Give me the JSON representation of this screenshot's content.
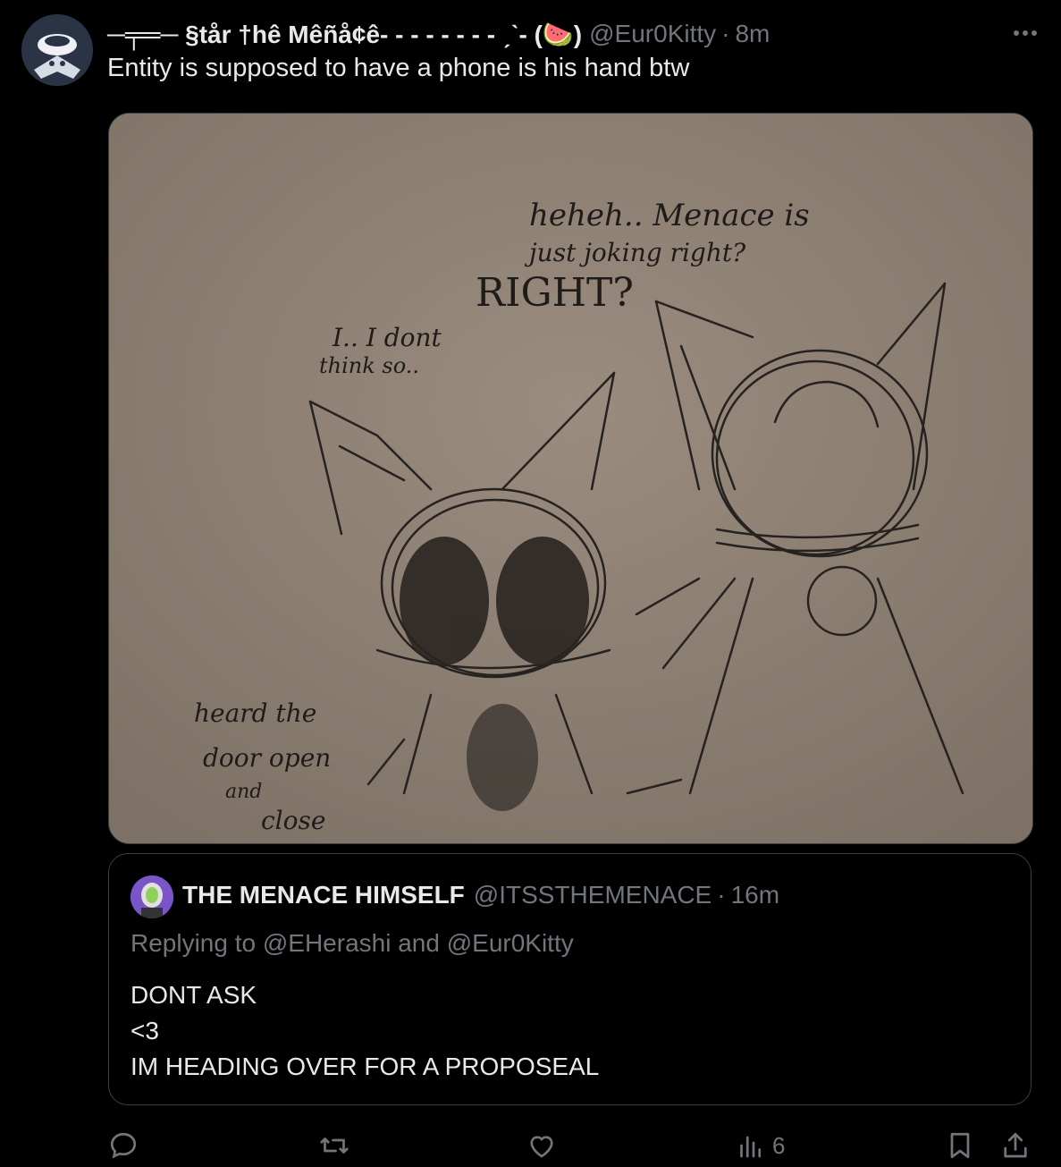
{
  "tweet": {
    "display_name": "─╤═─ §tår †hê Mêñå¢ê- - - - - - - - ˏˋ- (🍉)",
    "handle": "@Eur0Kitty",
    "dot": "·",
    "time": "8m",
    "text": "Entity is supposed to have a phone is his hand btw"
  },
  "drawing": {
    "speech_right_1": "heheh.. Menace is",
    "speech_right_2": "just joking right?",
    "speech_shout": "RIGHT?",
    "speech_left_1": "I.. I dont",
    "speech_left_2": "think so..",
    "note_1": "heard the",
    "note_2": "door open",
    "note_3": "and",
    "note_4": "close"
  },
  "quote": {
    "display_name": "THE MENACE HIMSELF",
    "handle": "@ITSSTHEMENACE",
    "dot": "·",
    "time": "16m",
    "replying_to": "Replying to @EHerashi and @Eur0Kitty",
    "lines": [
      "DONT ASK",
      "<3",
      "IM HEADING OVER FOR A PROPOSEAL"
    ]
  },
  "actions": {
    "views": "6"
  },
  "icons": {
    "more": "more-icon",
    "reply": "reply-icon",
    "retweet": "retweet-icon",
    "like": "heart-icon",
    "views": "views-icon",
    "bookmark": "bookmark-icon",
    "share": "share-icon"
  },
  "colors": {
    "background": "#000000",
    "text": "#e7e9ea",
    "secondary": "#71767b",
    "border": "#3a3f44"
  }
}
